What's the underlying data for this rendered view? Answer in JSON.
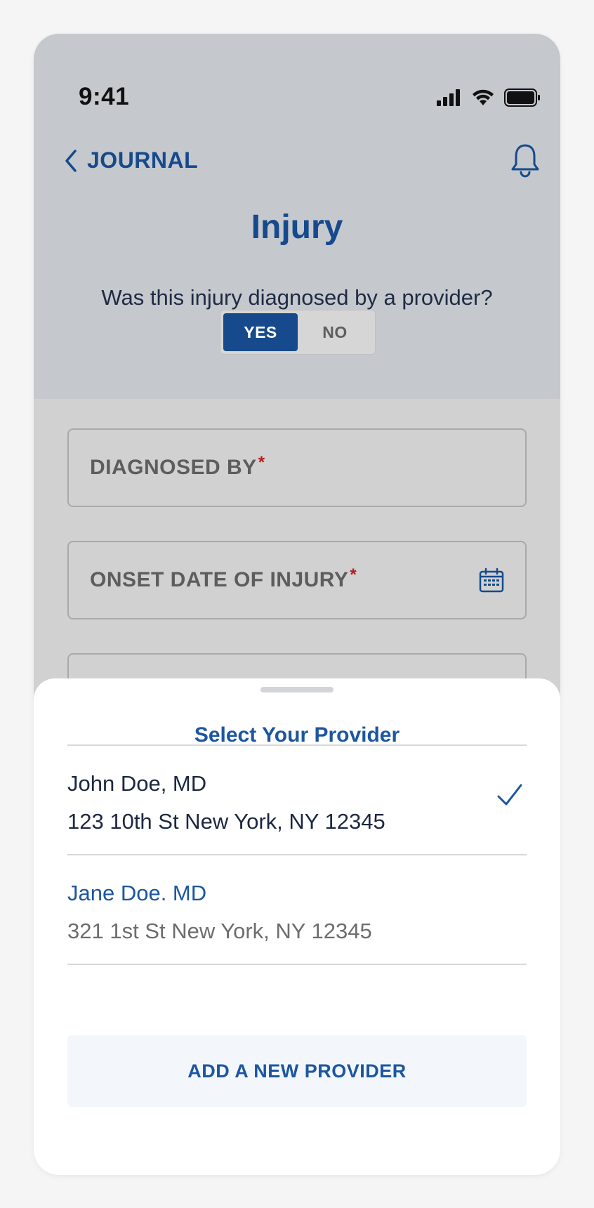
{
  "status_bar": {
    "time": "9:41"
  },
  "nav": {
    "back_label": "JOURNAL"
  },
  "page": {
    "title": "Injury",
    "question": "Was this injury diagnosed by a provider?",
    "toggle": {
      "yes_label": "YES",
      "no_label": "NO",
      "selected": "YES"
    }
  },
  "form": {
    "diagnosed_by_label": "DIAGNOSED BY",
    "onset_date_label": "ONSET DATE OF INJURY",
    "required_marker": "*"
  },
  "sheet": {
    "title": "Select Your Provider",
    "providers": [
      {
        "name": "John Doe, MD",
        "address": "123 10th St New York, NY 12345",
        "selected": true
      },
      {
        "name": "Jane Doe. MD",
        "address": "321 1st St New York, NY 12345",
        "selected": false
      }
    ],
    "add_button_label": "ADD A NEW PROVIDER"
  },
  "colors": {
    "brand_blue": "#164a8c",
    "link_blue": "#1c56a0",
    "required_red": "#b51a1a",
    "overlay_header": "#c5c8cd",
    "overlay_form": "#d1d1d1"
  },
  "icons": {
    "back": "chevron-left-icon",
    "notifications": "bell-icon",
    "calendar": "calendar-icon",
    "selected": "checkmark-icon",
    "signal": "cellular-signal-icon",
    "wifi": "wifi-icon",
    "battery": "battery-icon"
  }
}
